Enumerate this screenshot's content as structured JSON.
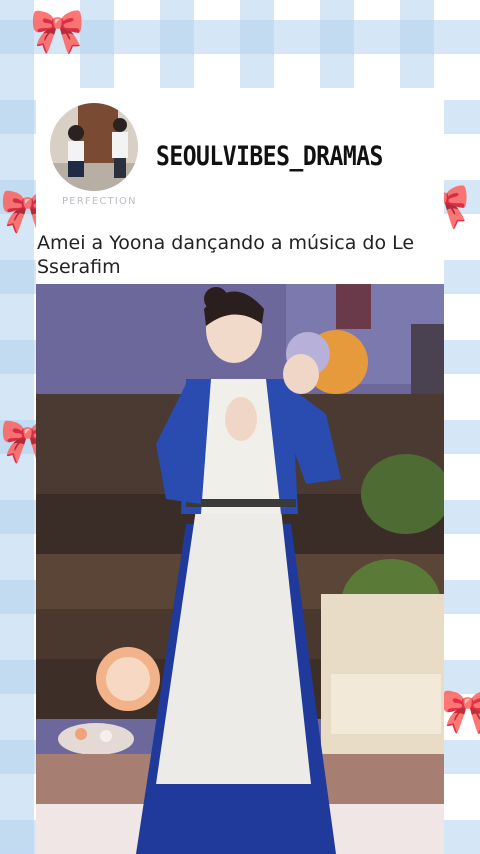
{
  "post": {
    "username": "SEOULVIBES_DRAMAS",
    "avatar_caption": "PERFECTION",
    "caption": "Amei a Yoona dançando a música do Le Sserafim"
  },
  "colors": {
    "background_stripes": "#b2d2ee",
    "card": "#ffffff",
    "ribbon": "#a9c9e6"
  },
  "icons": {
    "ribbon": "ribbon-icon",
    "heart": "heart-icon",
    "play": "media-video"
  }
}
